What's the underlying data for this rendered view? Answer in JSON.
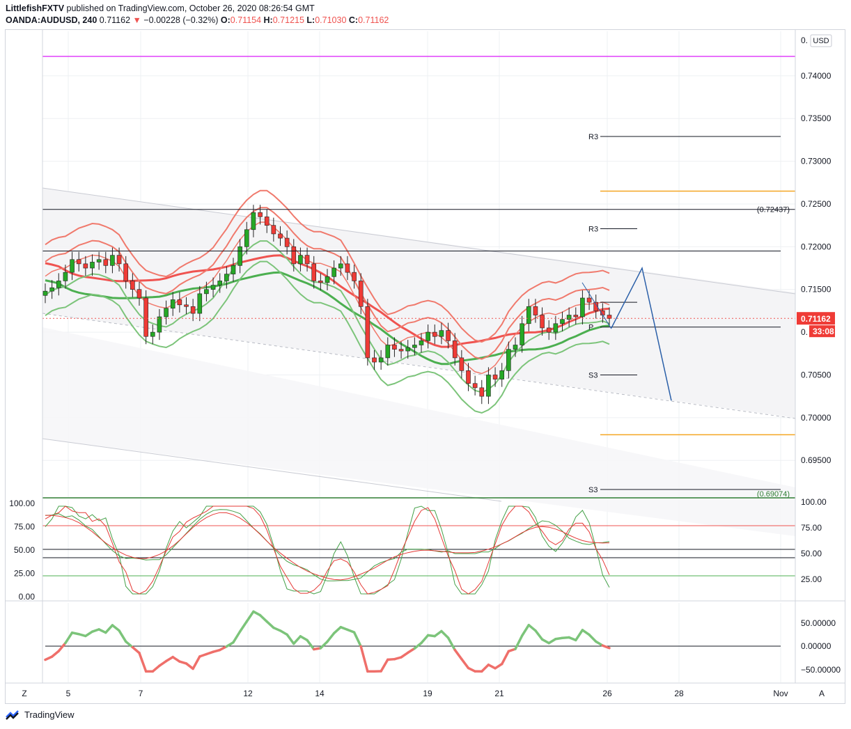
{
  "header": {
    "publisher": "LittlefishFXTV",
    "published_text": "published on TradingView.com, October 26, 2020 08:26:54 GMT",
    "symbol": "OANDA:AUDUSD, 240",
    "last": "0.71162",
    "change_arrow": "▼",
    "change": "−0.00228 (−0.32%)",
    "o_label": "O:",
    "o": "0.71154",
    "h_label": "H:",
    "h": "0.71215",
    "l_label": "L:",
    "l": "0.71030",
    "c_label": "C:",
    "c": "0.71162"
  },
  "price_axis": {
    "currency": "USD",
    "top_truncated": "0.",
    "labels": [
      "0.74000",
      "0.73500",
      "0.73000",
      "0.72500",
      "0.72000",
      "0.71500",
      "0.70500",
      "0.70000",
      "0.69500"
    ],
    "hidden_label_prefix": "0.",
    "last_price_badge": "0.71162",
    "countdown_badge": "33:08"
  },
  "x_axis": {
    "labels": [
      "5",
      "7",
      "12",
      "14",
      "19",
      "21",
      "26",
      "28",
      "Nov"
    ]
  },
  "annotations": {
    "level_high": "(0.72437)",
    "level_low": "(0.69074)",
    "pivots": [
      {
        "label": "R3",
        "value": 0.7329
      },
      {
        "label": "R3",
        "value": 0.7221
      },
      {
        "label": "P",
        "value": 0.7106
      },
      {
        "label": "S3",
        "value": 0.705
      },
      {
        "label": "S3",
        "value": 0.6916
      }
    ]
  },
  "stoch_panel": {
    "labels": [
      "100.00",
      "75.00",
      "50.00",
      "25.00"
    ],
    "left_labels": [
      "100.00",
      "75.00",
      "50.00",
      "25.00",
      "0.00"
    ]
  },
  "momentum_panel": {
    "labels": [
      "50.00000",
      "0.00000",
      "−50.00000"
    ]
  },
  "buttons": {
    "zoom": "Z",
    "auto": "A"
  },
  "footer": {
    "brand": "TradingView"
  },
  "colors": {
    "up": "#26a826",
    "down": "#ef3b36",
    "band_red": "#f0796c",
    "band_green": "#7cc47a",
    "projection": "#2a5fa8"
  },
  "chart_data": {
    "type": "candlestick",
    "symbol": "OANDA:AUDUSD",
    "timeframe": "240",
    "ylim": [
      0.6907,
      0.7452
    ],
    "x_dates": [
      "5",
      "7",
      "12",
      "14",
      "19",
      "21",
      "26",
      "28",
      "Nov"
    ],
    "horizontal_levels": [
      0.74283,
      0.72437,
      0.7195,
      0.7265,
      0.698
    ],
    "candles_close_approx": [
      0.7148,
      0.7152,
      0.716,
      0.717,
      0.7185,
      0.718,
      0.7175,
      0.7182,
      0.7185,
      0.7178,
      0.719,
      0.718,
      0.716,
      0.715,
      0.714,
      0.7095,
      0.71,
      0.7118,
      0.7128,
      0.7138,
      0.7132,
      0.713,
      0.7122,
      0.7145,
      0.715,
      0.7155,
      0.716,
      0.7168,
      0.7178,
      0.72,
      0.722,
      0.724,
      0.7235,
      0.7225,
      0.7215,
      0.721,
      0.72,
      0.718,
      0.719,
      0.718,
      0.716,
      0.7158,
      0.7165,
      0.7175,
      0.718,
      0.717,
      0.716,
      0.713,
      0.707,
      0.7065,
      0.707,
      0.7085,
      0.708,
      0.7078,
      0.7082,
      0.7085,
      0.709,
      0.71,
      0.7095,
      0.7102,
      0.709,
      0.707,
      0.7055,
      0.704,
      0.7035,
      0.7025,
      0.705,
      0.7045,
      0.7055,
      0.708,
      0.7085,
      0.711,
      0.713,
      0.712,
      0.7105,
      0.71,
      0.711,
      0.7115,
      0.712,
      0.7118,
      0.714,
      0.7135,
      0.7125,
      0.712,
      0.7116
    ],
    "stoch_oscillator_range": [
      0,
      100
    ],
    "stoch_levels": [
      80,
      50,
      20
    ],
    "momentum_range": [
      -50,
      50
    ]
  }
}
